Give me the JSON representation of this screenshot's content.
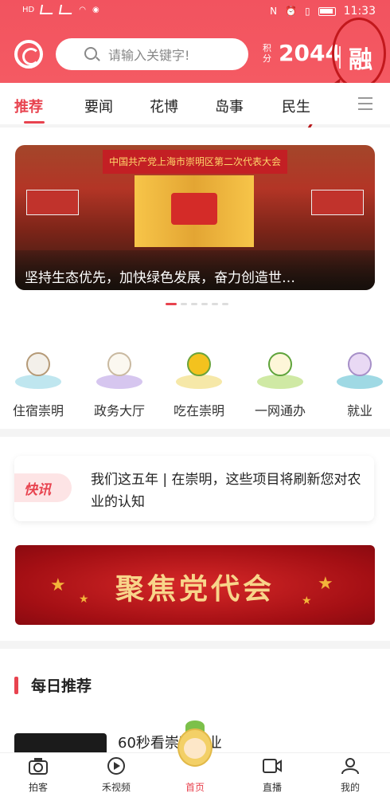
{
  "statusbar": {
    "left_text": "HD",
    "time": "11:33"
  },
  "header": {
    "search_placeholder": "请输入关键字!",
    "points_label": "积分",
    "points_value": "2044",
    "fusion_label": "融"
  },
  "tabs": [
    {
      "label": "推荐",
      "active": true
    },
    {
      "label": "要闻"
    },
    {
      "label": "花博"
    },
    {
      "label": "岛事"
    },
    {
      "label": "民生"
    }
  ],
  "banner": {
    "stage_title": "中国共产党上海市崇明区第二次代表大会",
    "caption": "坚持生态优先，加快绿色发展，奋力创造世…",
    "page_dots": 6,
    "active_dot": 0
  },
  "quick_links": [
    {
      "label": "住宿崇明",
      "icon": "cotton-icon"
    },
    {
      "label": "政务大厅",
      "icon": "magnolia-icon"
    },
    {
      "label": "吃在崇明",
      "icon": "osmanthus-icon"
    },
    {
      "label": "一网通办",
      "icon": "narcissus-icon"
    },
    {
      "label": "就业",
      "icon": "lotus-icon"
    }
  ],
  "flash_news": {
    "badge": "快讯",
    "text": "我们这五年 | 在崇明，这些项目将刷新您对农业的认知"
  },
  "party_banner": {
    "title": "聚焦党代会"
  },
  "daily": {
    "heading": "每日推荐",
    "item_title": "60秒看崇明农业"
  },
  "bottom_nav": [
    {
      "label": "拍客",
      "icon": "camera-icon"
    },
    {
      "label": "禾视频",
      "icon": "play-icon"
    },
    {
      "label": "首页",
      "icon": "home-mascot-icon",
      "active": true
    },
    {
      "label": "直播",
      "icon": "live-icon"
    },
    {
      "label": "我的",
      "icon": "user-icon"
    }
  ],
  "colors": {
    "accent": "#e8434f",
    "header": "#f2535f",
    "gold": "#f8d58a"
  }
}
